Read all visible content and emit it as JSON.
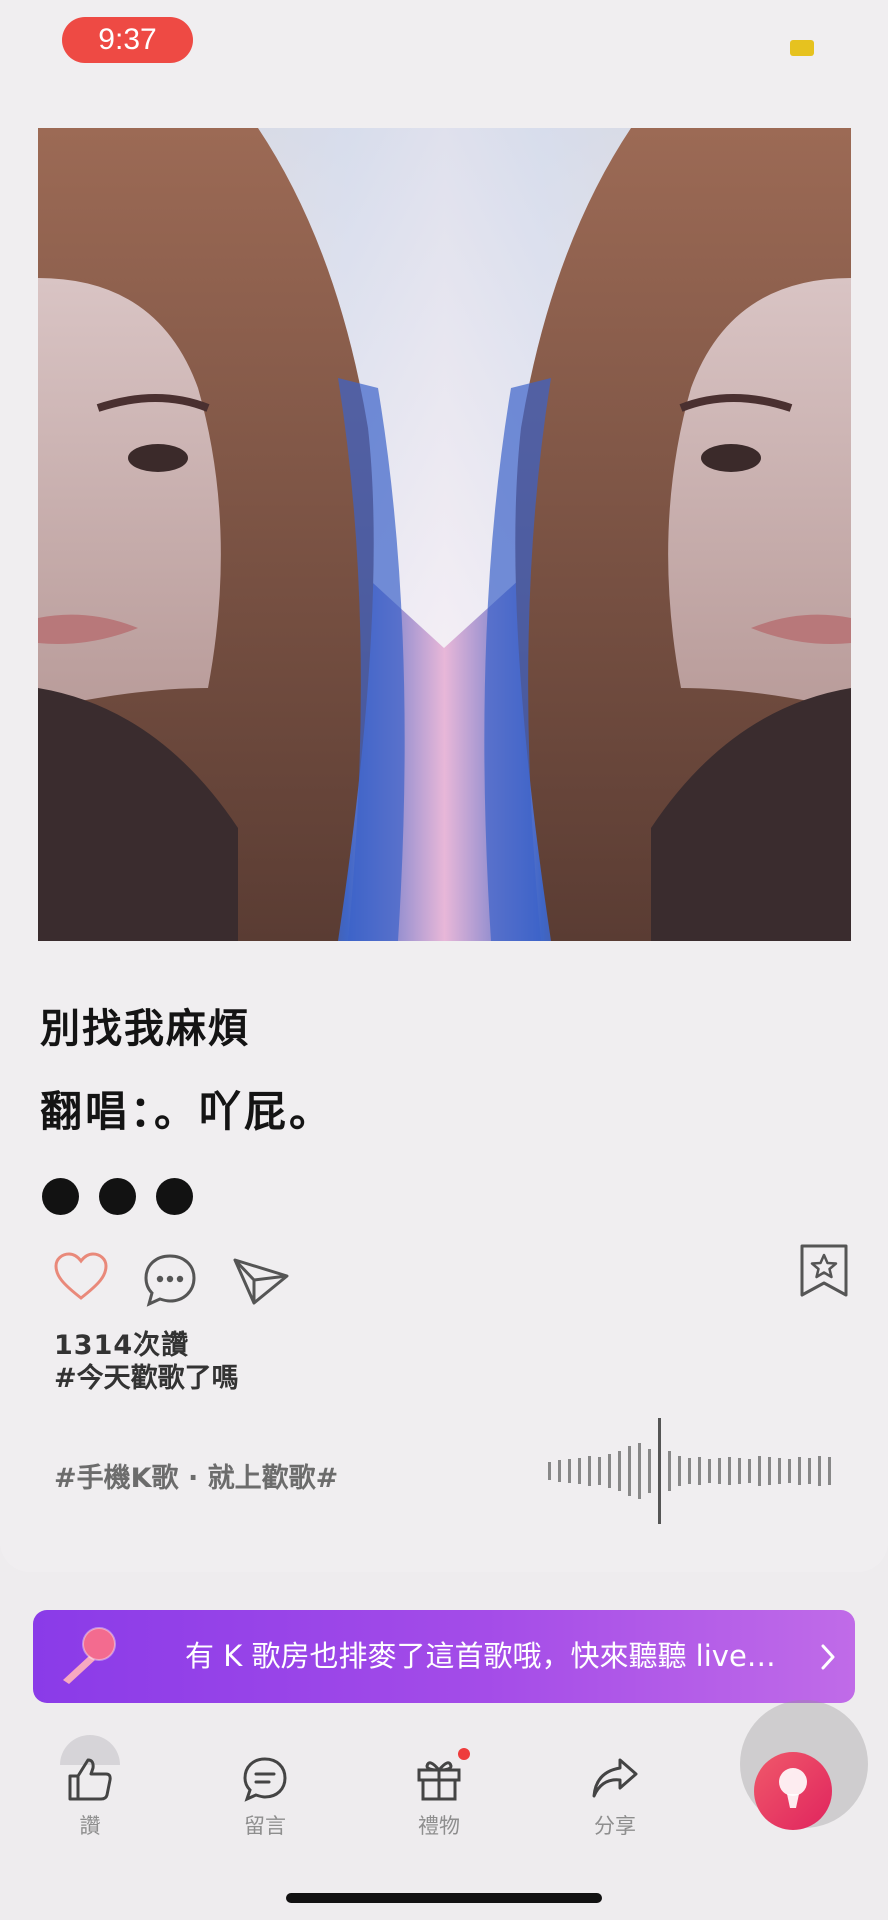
{
  "status_bar": {
    "time": "9:37"
  },
  "song": {
    "title": "別找我麻煩",
    "cover_line": "翻唱：。吖屁。",
    "likes": "1314次讚",
    "hashtag": "#今天歡歌了嗎",
    "slogan": "#手機K歌 · 就上歡歌#"
  },
  "banner": {
    "text": "有 K 歌房也排麥了這首歌哦，快來聽聽 live…"
  },
  "bottom_nav": [
    {
      "label": "讚",
      "icon": "thumbs-up-icon"
    },
    {
      "label": "留言",
      "icon": "comment-icon"
    },
    {
      "label": "禮物",
      "icon": "gift-icon"
    },
    {
      "label": "分享",
      "icon": "share-icon"
    }
  ],
  "colors": {
    "status_pill": "#ee4a44",
    "banner_start": "#8a3be8",
    "banner_end": "#c06be8",
    "like_outline": "#e9897a",
    "badge": "#ee3c3c"
  }
}
